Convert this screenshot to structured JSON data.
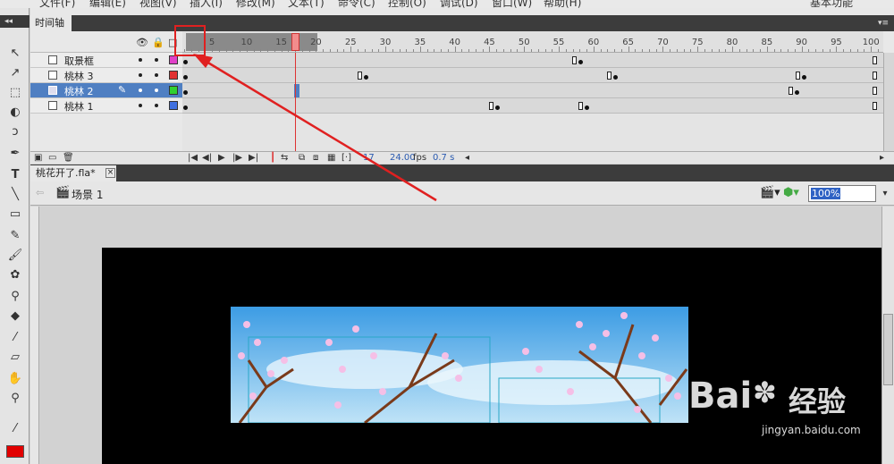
{
  "menu": [
    "文件(F)",
    "编辑(E)",
    "视图(V)",
    "插入(I)",
    "修改(M)",
    "文本(T)",
    "命令(C)",
    "控制(O)",
    "调试(D)",
    "窗口(W)",
    "帮助(H)",
    "基本功能"
  ],
  "timeline": {
    "tab_label": "时间轴",
    "ruler_numbers": [
      "5",
      "10",
      "15",
      "20",
      "25",
      "30",
      "35",
      "40",
      "45",
      "50",
      "55",
      "60",
      "65",
      "70",
      "75",
      "80",
      "85",
      "90",
      "95",
      "100"
    ],
    "current_frame": "17",
    "fps": "24.00",
    "fps_unit": "fps",
    "elapsed": "0.7 s",
    "layers": [
      {
        "name": "取景框",
        "color": "#e040c8",
        "selected": false
      },
      {
        "name": "桃林 3",
        "color": "#e03030",
        "selected": false
      },
      {
        "name": "桃林 2",
        "color": "#30d030",
        "selected": true
      },
      {
        "name": "桃林 1",
        "color": "#4070e0",
        "selected": false
      }
    ]
  },
  "document": {
    "tab_label": "桃花开了.fla*",
    "close_label": "×",
    "scene_label": "场景 1",
    "zoom_value": "100%"
  },
  "watermark": {
    "brand": "Bai",
    "brand2": "经验",
    "url": "jingyan.baidu.com"
  },
  "colors": {
    "stroke": "#e20000",
    "annotation": "#e02020",
    "selection": "#4f7fc2"
  }
}
